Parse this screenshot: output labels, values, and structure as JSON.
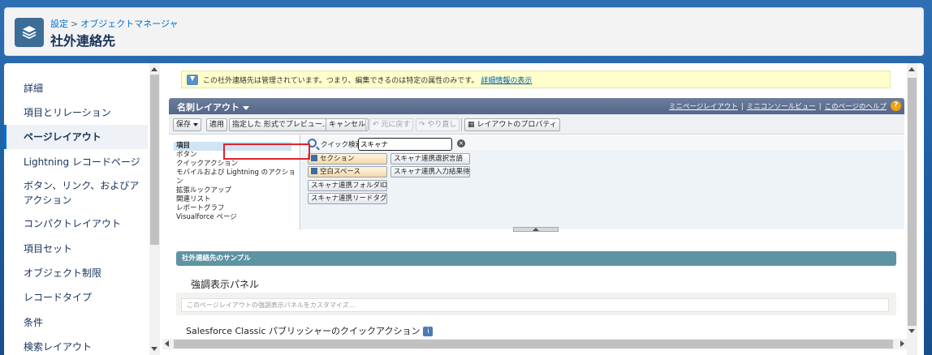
{
  "header": {
    "breadcrumb": [
      "設定",
      "オブジェクトマネージャ"
    ],
    "breadcrumb_sep": ">",
    "title": "社外連絡先"
  },
  "sidebar": {
    "items": [
      {
        "label": "詳細"
      },
      {
        "label": "項目とリレーション"
      },
      {
        "label": "ページレイアウト",
        "active": true
      },
      {
        "label": "Lightning レコードページ"
      },
      {
        "label": "ボタン、リンク、およびア"
      },
      {
        "label": "アクション"
      },
      {
        "label": "コンパクトレイアウト"
      },
      {
        "label": "項目セット"
      },
      {
        "label": "オブジェクト制限"
      },
      {
        "label": "レコードタイプ"
      },
      {
        "label": "条件"
      },
      {
        "label": "検索レイアウト"
      }
    ]
  },
  "notice": {
    "text": "この社外連絡先は管理されています。つまり、編集できるのは特定の属性のみです。",
    "link": "詳細情報の表示"
  },
  "layout_bar": {
    "title": "名刺レイアウト",
    "links": [
      "ミニページレイアウト",
      "ミニコンソールビュー",
      "このページのヘルプ"
    ],
    "link_sep": "|",
    "help_glyph": "?"
  },
  "toolbar": {
    "save": "保存",
    "apply": "適用",
    "preview": "指定した 形式でプレビュー...",
    "cancel": "キャンセル",
    "undo": "元に戻す",
    "redo": "やり直し",
    "properties": "レイアウトのプロパティ"
  },
  "palette": {
    "categories": [
      "項目",
      "ボタン",
      "クイックアクション",
      "モバイルおよび Lightning のアクション",
      "拡張ルックアップ",
      "関連リスト",
      "レポートグラフ",
      "Visualforce ページ"
    ],
    "search_label": "クイック検索",
    "search_value": "スキャナ",
    "clear_glyph": "×",
    "items": {
      "section": "セクション",
      "blank_space": "空白スペース",
      "folder_id": "スキャナ連携フォルダID",
      "lead_tag": "スキャナ連携リードタグ",
      "language": "スキャナ連携選択言語",
      "input_wait": "スキャナ連携入力結果待ち"
    }
  },
  "sample": {
    "header": "社外連絡先のサンプル",
    "section_title": "強調表示パネル",
    "section_placeholder": "このページレイアウトの強調表示パネルをカスタマイズ...",
    "qa_title": "Salesforce Classic パブリッシャーのクイックアクション",
    "qa_info": "i"
  }
}
